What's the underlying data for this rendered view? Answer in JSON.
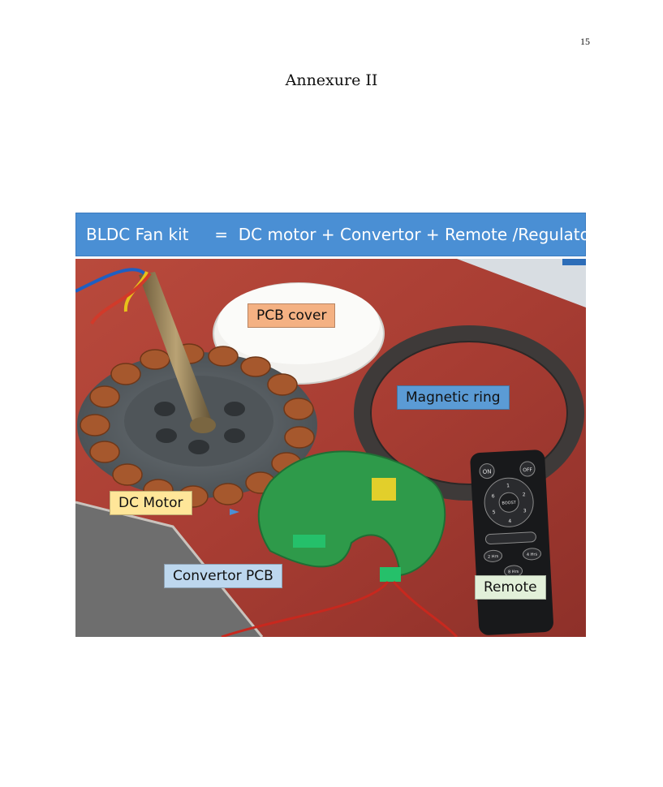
{
  "page": {
    "number": "15",
    "title": "Annexure II"
  },
  "figure": {
    "banner": "BLDC Fan kit     =  DC motor + Convertor + Remote /Regulator",
    "labels": {
      "pcb_cover": "PCB cover",
      "magnetic_ring": "Magnetic ring",
      "dc_motor": "DC Motor",
      "convertor_pcb": "Convertor PCB",
      "remote": "Remote"
    },
    "remote_buttons": {
      "on": "ON",
      "off": "OFF",
      "boost": "BOOST",
      "speeds": [
        "1",
        "2",
        "3",
        "4",
        "5",
        "6"
      ],
      "timers": [
        "2 Hrs",
        "4 Hrs",
        "8 Hrs"
      ]
    },
    "colors": {
      "banner": "#4a8fd4",
      "pcb_cover_label": "#f4b183",
      "magnetic_ring_label": "#5b9bd5",
      "dc_motor_label": "#ffe699",
      "convertor_pcb_label": "#bdd7ee",
      "remote_label": "#e2f0d9"
    }
  }
}
